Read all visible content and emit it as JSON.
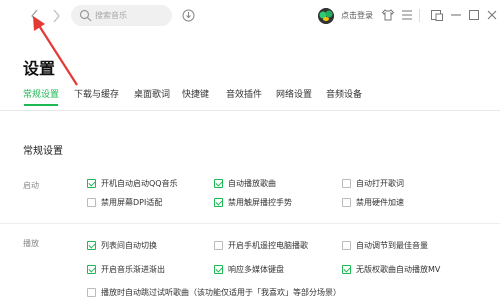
{
  "search": {
    "placeholder": "搜索音乐"
  },
  "header": {
    "login_label": "点击登录"
  },
  "page": {
    "title": "设置"
  },
  "tabs": [
    {
      "label": "常规设置",
      "active": true
    },
    {
      "label": "下载与缓存",
      "active": false
    },
    {
      "label": "桌面歌词",
      "active": false
    },
    {
      "label": "快捷键",
      "active": false
    },
    {
      "label": "音效插件",
      "active": false
    },
    {
      "label": "网络设置",
      "active": false
    },
    {
      "label": "音频设备",
      "active": false
    }
  ],
  "section": {
    "title": "常规设置"
  },
  "groups": {
    "startup": {
      "label": "启动",
      "options": [
        {
          "label": "开机自动启动QQ音乐",
          "checked": true
        },
        {
          "label": "自动播放歌曲",
          "checked": true
        },
        {
          "label": "自动打开歌词",
          "checked": false
        },
        {
          "label": "禁用屏幕DPI适配",
          "checked": false
        },
        {
          "label": "禁用触屏播控手势",
          "checked": true
        },
        {
          "label": "禁用硬件加速",
          "checked": false
        }
      ]
    },
    "playback": {
      "label": "播放",
      "options": [
        {
          "label": "列表间自动切换",
          "checked": true
        },
        {
          "label": "开启手机遥控电脑播歌",
          "checked": false
        },
        {
          "label": "自动调节到最佳音量",
          "checked": false
        },
        {
          "label": "开启音乐渐进渐出",
          "checked": true
        },
        {
          "label": "响应多媒体键盘",
          "checked": true
        },
        {
          "label": "无版权歌曲自动播放MV",
          "checked": true
        },
        {
          "label": "播放时自动跳过试听歌曲（该功能仅适用于「我喜欢」等部分场景）",
          "checked": false
        }
      ]
    }
  },
  "colors": {
    "accent": "#1db954",
    "annotation_arrow": "#e53935"
  }
}
